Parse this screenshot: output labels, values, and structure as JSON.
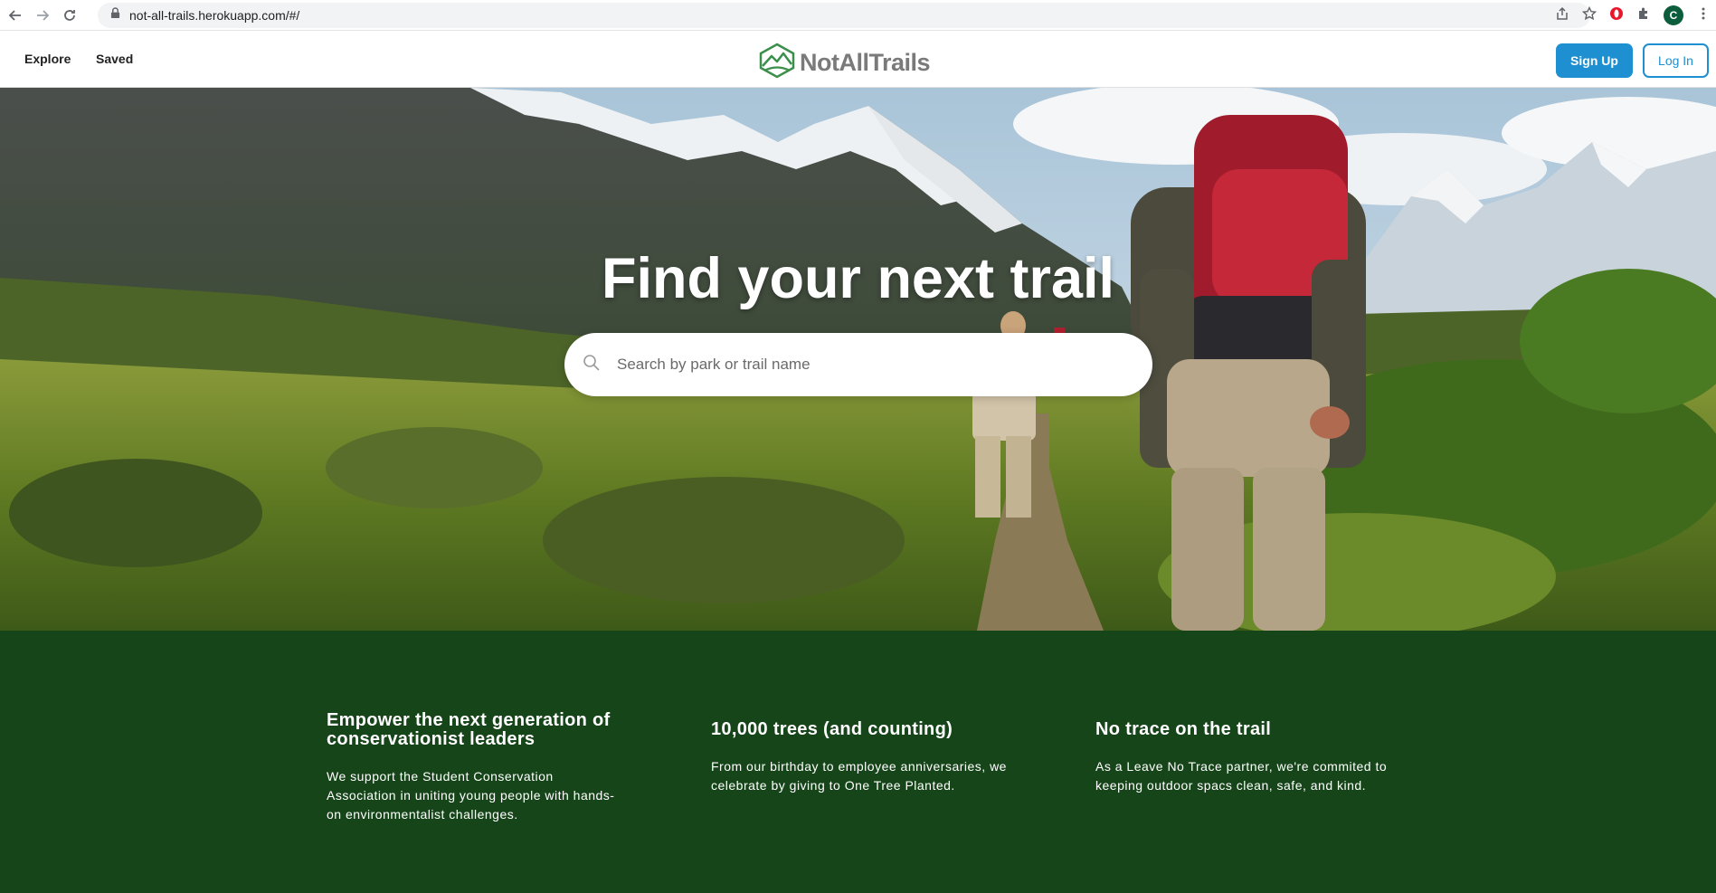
{
  "browser": {
    "url": "not-all-trails.herokuapp.com/#/",
    "profile_initial": "C"
  },
  "header": {
    "nav": [
      {
        "label": "Explore"
      },
      {
        "label": "Saved"
      }
    ],
    "logo_text": "NotAllTrails",
    "signup_label": "Sign Up",
    "login_label": "Log In"
  },
  "hero": {
    "title": "Find your next trail",
    "search_placeholder": "Search by park or trail name"
  },
  "info": [
    {
      "title": "Empower the next generation of conservationist leaders",
      "body": "We support the Student Conservation Association in uniting young people with hands-on environmentalist challenges."
    },
    {
      "title": "10,000 trees (and counting)",
      "body": "From our birthday to employee anniversaries, we celebrate by giving to One Tree Planted."
    },
    {
      "title": "No trace on the trail",
      "body": "As a Leave No Trace partner, we're commited to keeping outdoor spacs clean, safe, and kind."
    }
  ],
  "colors": {
    "accent": "#1e8fd0",
    "band": "#17451a",
    "logo_green": "#3a8f4a"
  }
}
